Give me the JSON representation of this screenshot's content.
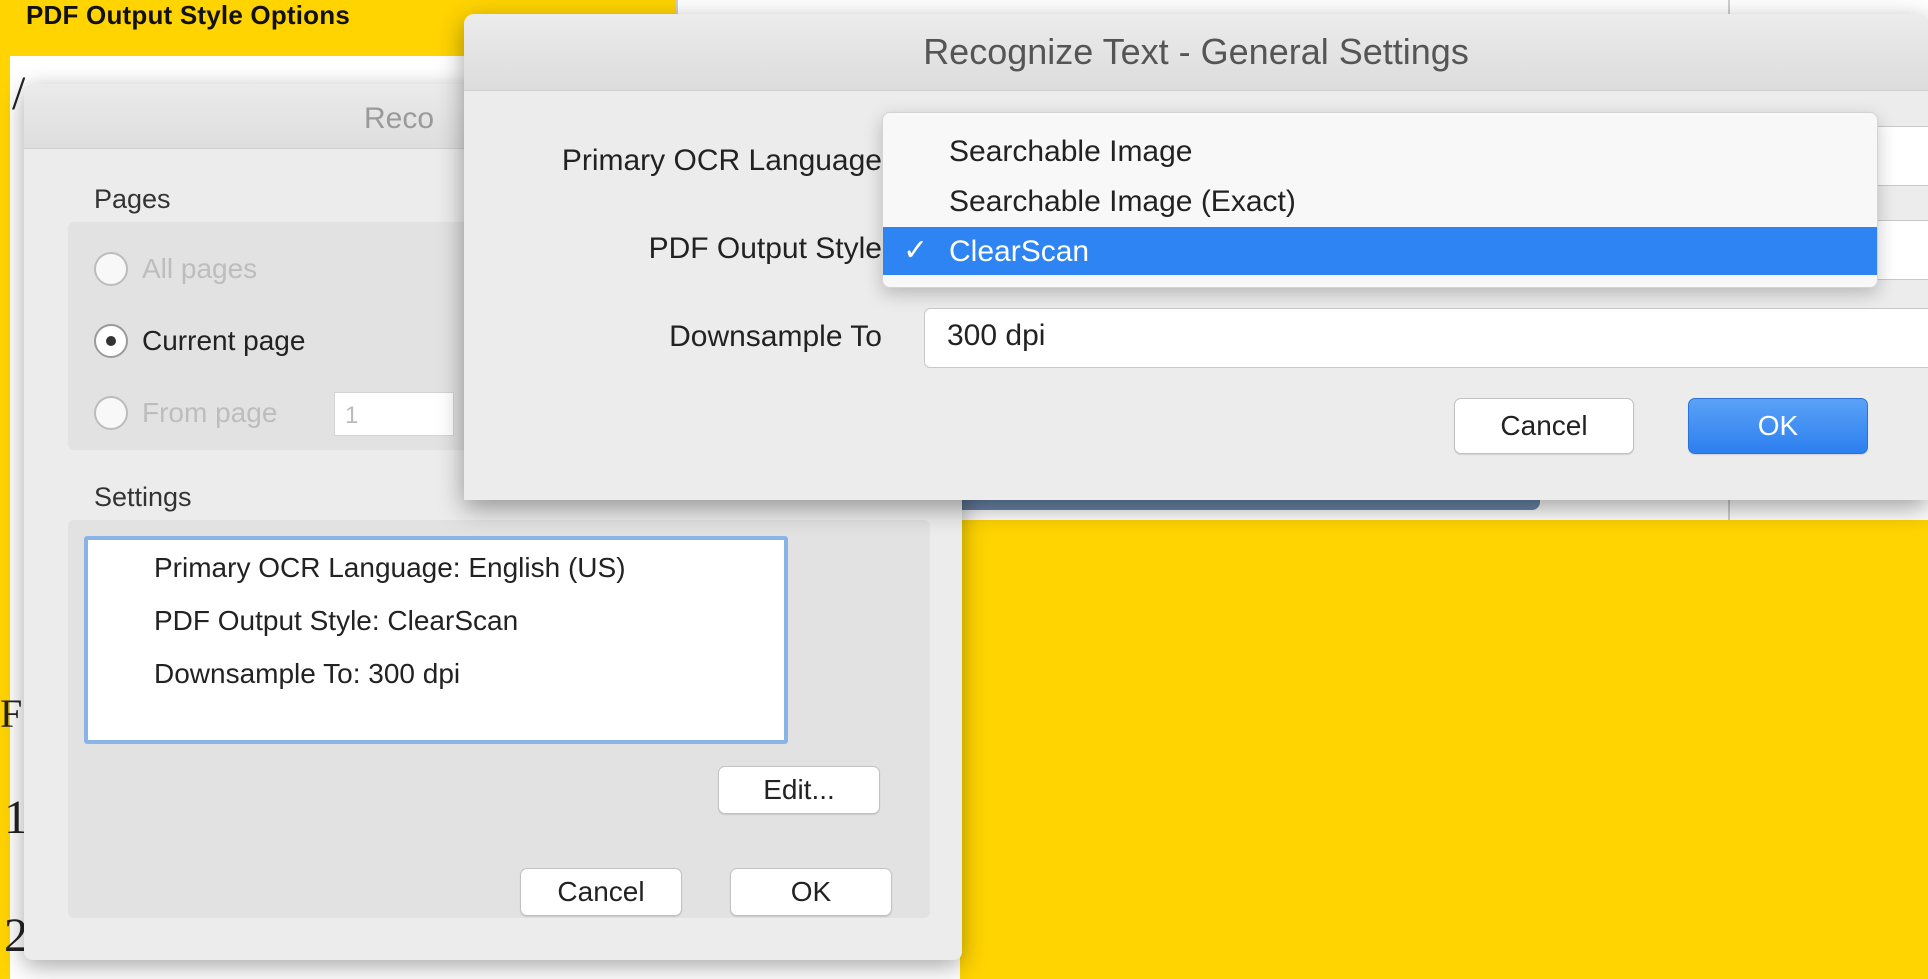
{
  "caption": "PDF Output Style Options",
  "background": {
    "glyphs": [
      "/",
      "F",
      "1",
      "2"
    ]
  },
  "back_dialog": {
    "title": "Reco",
    "pages": {
      "label": "Pages",
      "all_pages": "All pages",
      "current_page": "Current page",
      "from_page": "From page",
      "from_value": "1"
    },
    "settings": {
      "label": "Settings",
      "items": [
        "Primary OCR Language: English (US)",
        "PDF Output Style: ClearScan",
        "Downsample To: 300 dpi"
      ],
      "edit_label": "Edit..."
    },
    "cancel_label": "Cancel",
    "ok_label": "OK"
  },
  "front_dialog": {
    "title": "Recognize Text - General Settings",
    "primary_ocr_label": "Primary OCR Language",
    "pdf_output_label": "PDF Output Style",
    "downsample_label": "Downsample To",
    "downsample_value": "300 dpi",
    "pdf_output_menu": {
      "options": [
        "Searchable Image",
        "Searchable Image (Exact)",
        "ClearScan"
      ],
      "selected": "ClearScan",
      "check_glyph": "✓"
    },
    "cancel_label": "Cancel",
    "ok_label": "OK"
  },
  "colors": {
    "background": "#FFD400",
    "accent": "#2E84F3"
  }
}
